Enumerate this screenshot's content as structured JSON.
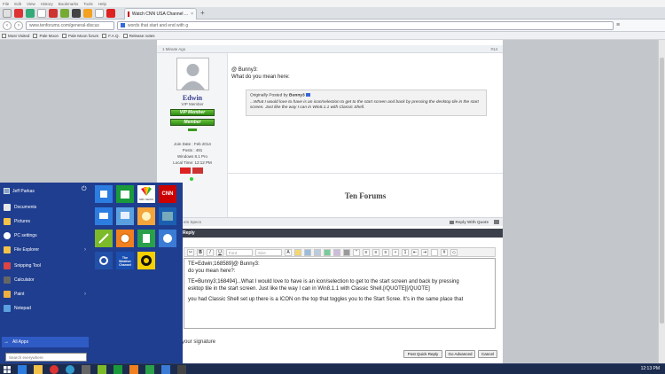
{
  "menu": [
    "File",
    "Edit",
    "View",
    "History",
    "Bookmarks",
    "Tools",
    "Help"
  ],
  "tab": {
    "title": "Watch CNN USA Channel ...",
    "close": "×",
    "new": "+"
  },
  "nav": {
    "url": "www.tenforums.com/general-discus",
    "search": "words that start and end with g"
  },
  "bookmarks": [
    "Most Visited",
    "Pale Moon",
    "Pale Moon forum",
    "F.A.Q.",
    "Release notes"
  ],
  "post": {
    "time": "1 Minute Ago",
    "number": "#14",
    "user": {
      "name": "Edwin",
      "title": "VIP Member",
      "rank1": "VIP Member",
      "rank2": "Member",
      "join": "Join Date : Feb 2014",
      "posts": "Posts : 491",
      "os": "Windows 8.1 Pro",
      "localtime": "Local Time: 12:12 PM"
    },
    "greeting": "@ Bunny3:",
    "question": "What do you mean here:",
    "quote_by": "Originally Posted by",
    "quote_author": "Bunny3",
    "quote_text": "...What I would love to have is an icon/selection to get to the start screen and back by pressing the desktop tile in the start screen. Just like the way I can in Win8.1.1 with Classic Shell.",
    "signature": "Ten Forums",
    "specs": "em Specs",
    "reply_quote": "Reply With Quote"
  },
  "quick_reply": {
    "header": "Reply",
    "font_placeholder": "Font",
    "size_placeholder": "Size",
    "line1": "TE=Edwin;168589]@ Bunny3:",
    "line2": "do you mean here?:",
    "line3": "TE=Bunny3;168494]...What I would love to have is an icon/selection to get to the start screen and back by pressing",
    "line4": "esktop tile in the start screen. Just like the way I can in Win8.1.1 with Classic Shell.[/QUOTE][/QUOTE]",
    "line5": "you had Classic Shell set up there is a ICON on the top that toggles you to the Start Scree. It's in the same place that",
    "signature_label": "your signature",
    "post_btn": "Post Quick Reply",
    "advanced_btn": "Go Advanced",
    "cancel_btn": "Cancel"
  },
  "startmenu": {
    "user": "Jeff Parkas",
    "items": [
      "Documents",
      "Pictures",
      "PC settings",
      "File Explorer",
      "Snipping Tool",
      "Calculator",
      "Paint",
      "Notepad"
    ],
    "all_apps": "All Apps",
    "search_placeholder": "Search everywhere",
    "tiles": {
      "nbc": "NBC NEWS",
      "cnn": "CNN",
      "weather": "The Weather Channel"
    }
  },
  "taskbar": {
    "time": "12:13 PM"
  },
  "colors": {
    "start_bg": "#1f3e8f",
    "cnn_red": "#cc0000",
    "taskbar": "#1c2c4f",
    "vip_green": "#3a9a1e"
  }
}
